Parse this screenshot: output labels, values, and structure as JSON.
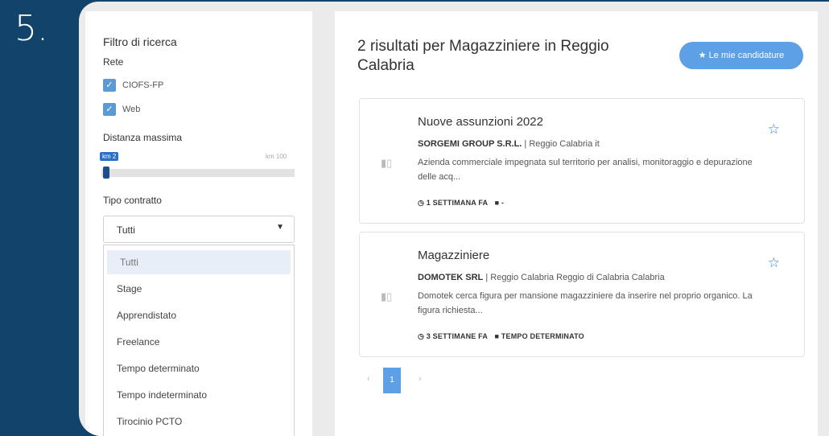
{
  "step_number": "5.",
  "filter": {
    "title": "Filtro di ricerca",
    "network_label": "Rete",
    "networks": [
      {
        "label": "CIOFS-FP",
        "checked": true
      },
      {
        "label": "Web",
        "checked": true
      }
    ],
    "distance_label": "Distanza massima",
    "distance_value": "km 2",
    "distance_max": "km 100",
    "distance_fraction": 0.02,
    "contract_label": "Tipo contratto",
    "contract_selected": "Tutti",
    "contract_options": [
      "Tutti",
      "Stage",
      "Apprendistato",
      "Freelance",
      "Tempo determinato",
      "Tempo indeterminato",
      "Tirocinio PCTO"
    ]
  },
  "results": {
    "title": "2 risultati per Magazziniere in Reggio Calabria",
    "applications_button": "Le mie candidature",
    "cards": [
      {
        "title": "Nuove assunzioni 2022",
        "company": "SORGEMI GROUP S.R.L.",
        "location": " | Reggio Calabria it",
        "description": "Azienda commerciale impegnata sul territorio per analisi, monitoraggio e depurazione delle acq...",
        "time": "1 SETTIMANA FA",
        "contract": "-"
      },
      {
        "title": "Magazziniere",
        "company": "DOMOTEK SRL",
        "location": " | Reggio Calabria Reggio di Calabria Calabria",
        "description": "Domotek cerca figura per mansione magazziniere da inserire nel proprio organico. La figura richiesta...",
        "time": "3 SETTIMANE FA",
        "contract": "TEMPO DETERMINATO"
      }
    ],
    "pagination": {
      "prev": "‹",
      "current": "1",
      "next": "›"
    }
  },
  "icons": {
    "check": "check-icon",
    "star": "star-outline-icon",
    "clock": "clock-icon",
    "briefcase": "briefcase-icon",
    "logo": "company-logo-icon",
    "caret": "caret-down-icon"
  },
  "colors": {
    "background": "#12436b",
    "accent": "#5ea0e6",
    "checkbox": "#5b9bd5"
  }
}
